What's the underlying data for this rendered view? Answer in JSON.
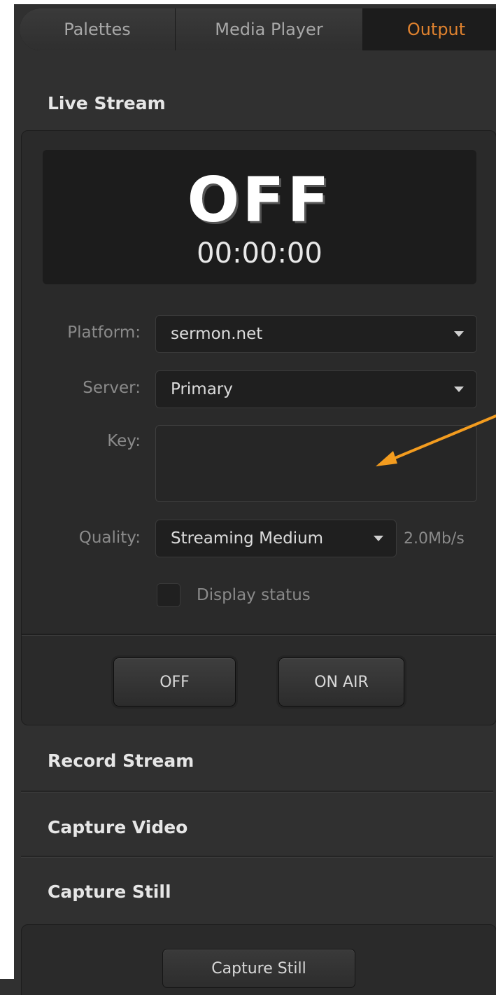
{
  "tabs": [
    {
      "label": "Palettes"
    },
    {
      "label": "Media Player"
    },
    {
      "label": "Output"
    }
  ],
  "active_tab": "Output",
  "accent_color": "#e0822e",
  "live_stream": {
    "header": "Live Stream",
    "status": "OFF",
    "timer": "00:00:00",
    "platform_label": "Platform:",
    "platform_value": "sermon.net",
    "server_label": "Server:",
    "server_value": "Primary",
    "key_label": "Key:",
    "key_value": "",
    "quality_label": "Quality:",
    "quality_value": "Streaming Medium",
    "bitrate": "2.0Mb/s",
    "display_status_label": "Display status",
    "display_status_checked": false,
    "off_button": "OFF",
    "on_air_button": "ON AIR"
  },
  "sections": {
    "record_stream": "Record Stream",
    "capture_video": "Capture Video",
    "capture_still": "Capture Still"
  },
  "capture_still_button": "Capture Still",
  "annotation": {
    "arrow_color": "#f39c1f",
    "points_to": "key-input"
  }
}
